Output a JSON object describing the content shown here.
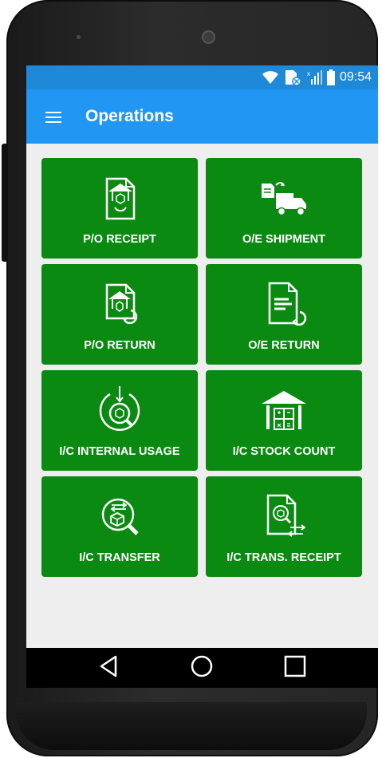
{
  "status_bar": {
    "time": "09:54",
    "icons": [
      "wifi-icon",
      "sim-icon",
      "signal-icon",
      "battery-icon"
    ]
  },
  "app_bar": {
    "title": "Operations",
    "menu_icon": "hamburger-menu-icon"
  },
  "tiles": [
    {
      "label": "P/O RECEIPT",
      "icon": "po-receipt-icon"
    },
    {
      "label": "O/E SHIPMENT",
      "icon": "truck-shipment-icon"
    },
    {
      "label": "P/O RETURN",
      "icon": "po-return-icon"
    },
    {
      "label": "O/E RETURN",
      "icon": "oe-return-icon"
    },
    {
      "label": "I/C INTERNAL USAGE",
      "icon": "internal-usage-icon"
    },
    {
      "label": "I/C STOCK COUNT",
      "icon": "warehouse-icon"
    },
    {
      "label": "I/C TRANSFER",
      "icon": "transfer-icon"
    },
    {
      "label": "I/C TRANS. RECEIPT",
      "icon": "trans-receipt-icon"
    }
  ],
  "nav_bar": {
    "buttons": [
      "back-icon",
      "home-icon",
      "recents-icon"
    ]
  },
  "colors": {
    "status_bar": "#1e88d9",
    "app_bar": "#2196f3",
    "tile": "#0b8a12",
    "background": "#eeeeee"
  }
}
